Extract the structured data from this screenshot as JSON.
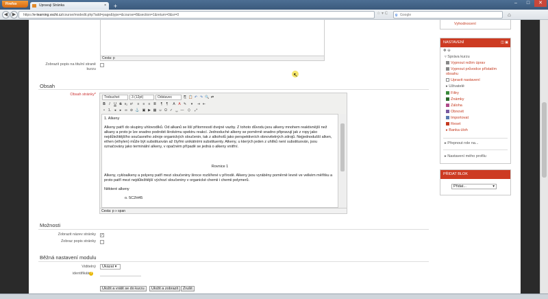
{
  "browser": {
    "menu_label": "Firefox",
    "tab_title": "Upravuji Stránka",
    "url_prefix": "https://",
    "url_host": "e-learning.vscht.cz",
    "url_path": "/course/modedit.php?add=page&type=&course=8&section=1&return=0&sr=0",
    "search_engine": "Google",
    "search_placeholder": "Google"
  },
  "form": {
    "prev_editor_path": "Cesta: p",
    "show_desc_label": "Zobrazit popis na titulní straně kurzu",
    "content_section": "Obsah",
    "content_label": "Obsah stránky*",
    "font_family": "Trebuchet",
    "font_size": "3 (12pt)",
    "format": "Odstavec",
    "editor_path": "Cesta: p » span",
    "options_section": "Možnosti",
    "show_name_label": "Zobrazit název stránky",
    "show_desc2_label": "Zobraz popis stránky",
    "common_section": "Běžná nastavení modulu",
    "visible_label": "Viditelný",
    "visible_value": "Ukázat",
    "idnumber_label": "identifikátor",
    "buttons": {
      "save_return": "Uložit a vrátit se do kurzu",
      "save_show": "Uložit a zobrazit",
      "cancel": "Zrušit"
    }
  },
  "editor_content": {
    "heading": "1. Alkeny",
    "para1": "Alkeny patří do skupiny uhlovodíků. Od alkanů se liší přítomností dvojné vazby. Z tohoto důvodu jsou alkeny mnohem reaktivnější než alkany a proto je lze snadno podrobit širokému spektru reakcí. Jednoduché alkeny se poměrně snadno připravují jak z ropy jako nejdůležitějšího současného zdroje organických sloučenin, tak z alkoholů jako perspektivních obnovitelných zdrojů. Nejjednodušší alken, ethen (ethylen) může být substituován až čtyřmi unikátními substituenty. Alkeny, u kterých jeden z uhlíků není substituován, jsou označovány jako terminální alkeny, v opačném případě se jedná o alkeny vnitřní.",
    "equation": "Rovnice 1",
    "para2": "Alkeny, cykloalkeny a polyeny patří mezi sloučeniny široce rozšířené v přírodě. Alkeny jsou vyráběny poměrně levně ve velkém měřítku a proto patří mezi nejdůležitější výchozí sloučeniny v organické chemii i chemii polymerů.",
    "para3": "Některé alkeny",
    "list_item": "o. 5C2H45"
  },
  "sidebar": {
    "top_link": "Vyhodnocení",
    "settings_title": "NASTAVENÍ",
    "course_admin": "Správa kurzu",
    "items": [
      {
        "label": "Vypnout režim úprav",
        "icon": "pencil-icon"
      },
      {
        "label": "Vypnout průvodce přístatím obsahu",
        "icon": "pencil-icon"
      },
      {
        "label": "Upravit nastavení",
        "icon": "page-icon"
      },
      {
        "label": "Uživatelé",
        "icon": "users-icon"
      },
      {
        "label": "Filtry",
        "icon": "filter-icon"
      },
      {
        "label": "Známky",
        "icon": "grades-icon"
      },
      {
        "label": "Záloha",
        "icon": "backup-icon"
      },
      {
        "label": "Obnovit",
        "icon": "restore-icon"
      },
      {
        "label": "Importovat",
        "icon": "import-icon"
      },
      {
        "label": "Reset",
        "icon": "reset-icon"
      },
      {
        "label": "Banka úloh",
        "icon": "bank-icon"
      }
    ],
    "switch_role": "Přepnout role na...",
    "profile_settings": "Nastavení mého profilu",
    "add_block_title": "PŘIDAT BLOK",
    "add_block_value": "Přidat..."
  }
}
